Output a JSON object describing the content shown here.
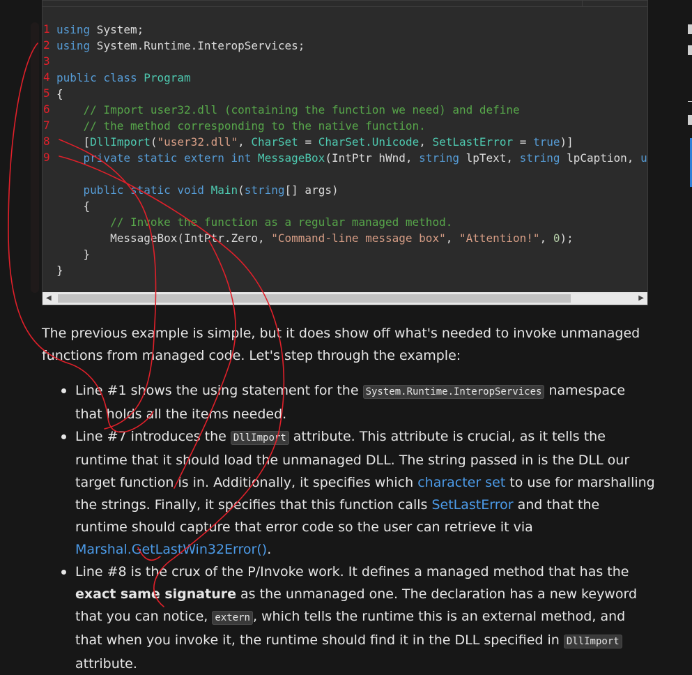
{
  "code": {
    "lines": [
      [
        {
          "t": "using",
          "c": "kw"
        },
        {
          "t": " System;",
          "c": "plain"
        }
      ],
      [
        {
          "t": "using",
          "c": "kw"
        },
        {
          "t": " System.Runtime.InteropServices;",
          "c": "plain"
        }
      ],
      [],
      [
        {
          "t": "public class ",
          "c": "kw"
        },
        {
          "t": "Program",
          "c": "ty"
        }
      ],
      [
        {
          "t": "{",
          "c": "plain"
        }
      ],
      [
        {
          "t": "    // Import user32.dll (containing the function we need) and define",
          "c": "cm"
        }
      ],
      [
        {
          "t": "    // the method corresponding to the native function.",
          "c": "cm"
        }
      ],
      [
        {
          "t": "    [",
          "c": "plain"
        },
        {
          "t": "DllImport",
          "c": "ty"
        },
        {
          "t": "(",
          "c": "plain"
        },
        {
          "t": "\"user32.dll\"",
          "c": "str"
        },
        {
          "t": ", ",
          "c": "plain"
        },
        {
          "t": "CharSet",
          "c": "ty"
        },
        {
          "t": " = ",
          "c": "plain"
        },
        {
          "t": "CharSet.Unicode",
          "c": "ty"
        },
        {
          "t": ", ",
          "c": "plain"
        },
        {
          "t": "SetLastError",
          "c": "ty"
        },
        {
          "t": " = ",
          "c": "plain"
        },
        {
          "t": "true",
          "c": "kw"
        },
        {
          "t": ")]",
          "c": "plain"
        }
      ],
      [
        {
          "t": "    private static extern int ",
          "c": "kw"
        },
        {
          "t": "MessageBox",
          "c": "ty"
        },
        {
          "t": "(IntPtr hWnd, ",
          "c": "plain"
        },
        {
          "t": "string",
          "c": "kw"
        },
        {
          "t": " lpText, ",
          "c": "plain"
        },
        {
          "t": "string",
          "c": "kw"
        },
        {
          "t": " lpCaption, ",
          "c": "plain"
        },
        {
          "t": "u",
          "c": "kw"
        }
      ],
      [],
      [
        {
          "t": "    public static void ",
          "c": "kw"
        },
        {
          "t": "Main",
          "c": "ty"
        },
        {
          "t": "(",
          "c": "plain"
        },
        {
          "t": "string",
          "c": "kw"
        },
        {
          "t": "[] args)",
          "c": "plain"
        }
      ],
      [
        {
          "t": "    {",
          "c": "plain"
        }
      ],
      [
        {
          "t": "        // Invoke the function as a regular managed method.",
          "c": "cm"
        }
      ],
      [
        {
          "t": "        MessageBox(IntPtr.Zero, ",
          "c": "plain"
        },
        {
          "t": "\"Command-line message box\"",
          "c": "str"
        },
        {
          "t": ", ",
          "c": "plain"
        },
        {
          "t": "\"Attention!\"",
          "c": "str"
        },
        {
          "t": ", ",
          "c": "plain"
        },
        {
          "t": "0",
          "c": "nm"
        },
        {
          "t": ");",
          "c": "plain"
        }
      ],
      [
        {
          "t": "    }",
          "c": "plain"
        }
      ],
      [
        {
          "t": "}",
          "c": "plain"
        }
      ]
    ]
  },
  "annotations": {
    "line_numbers": [
      "1",
      "2",
      "3",
      "4",
      "5",
      "6",
      "7",
      "8",
      "9"
    ],
    "color": "#e0202a"
  },
  "prose": {
    "intro": "The previous example is simple, but it does show off what's needed to invoke unmanaged functions from managed code. Let's step through the example:",
    "bullets": [
      [
        {
          "type": "text",
          "v": "Line #1 shows the using statement for the "
        },
        {
          "type": "code",
          "v": "System.Runtime.InteropServices"
        },
        {
          "type": "text",
          "v": " namespace that holds all the items needed."
        }
      ],
      [
        {
          "type": "text",
          "v": "Line #7 introduces the "
        },
        {
          "type": "code",
          "v": "DllImport"
        },
        {
          "type": "text",
          "v": " attribute. This attribute is crucial, as it tells the runtime that it should load the unmanaged DLL. The string passed in is the DLL our target function is in. Additionally, it specifies which "
        },
        {
          "type": "link",
          "v": "character set"
        },
        {
          "type": "text",
          "v": " to use for marshalling the strings. Finally, it specifies that this function calls "
        },
        {
          "type": "link",
          "v": "SetLastError"
        },
        {
          "type": "text",
          "v": " and that the runtime should capture that error code so the user can retrieve it via "
        },
        {
          "type": "link",
          "v": "Marshal.GetLastWin32Error()"
        },
        {
          "type": "text",
          "v": "."
        }
      ],
      [
        {
          "type": "text",
          "v": "Line #8 is the crux of the P/Invoke work. It defines a managed method that has the "
        },
        {
          "type": "bold",
          "v": "exact same signature"
        },
        {
          "type": "text",
          "v": " as the unmanaged one. The declaration has a new keyword that you can notice, "
        },
        {
          "type": "code",
          "v": "extern"
        },
        {
          "type": "text",
          "v": ", which tells the runtime this is an external method, and that when you invoke it, the runtime should find it in the DLL specified in "
        },
        {
          "type": "code",
          "v": "DllImport"
        },
        {
          "type": "text",
          "v": " attribute."
        }
      ]
    ]
  },
  "colors": {
    "background": "#171717",
    "code_bg": "#2b2b2b",
    "link": "#4c9be8",
    "ink": "#e0202a"
  }
}
